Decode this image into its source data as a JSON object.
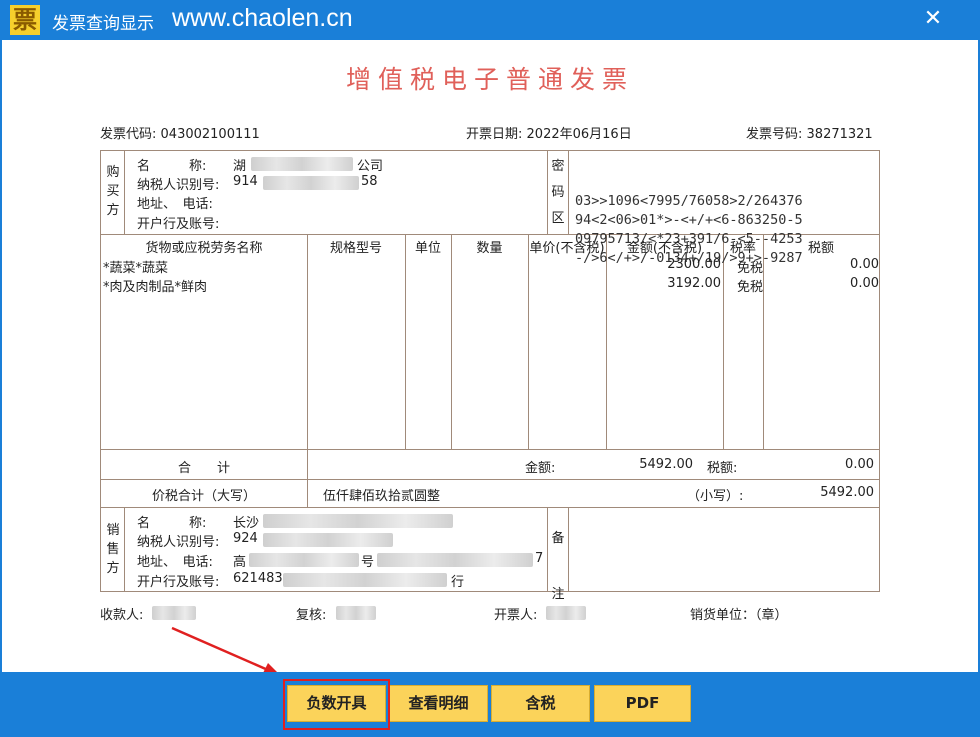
{
  "window": {
    "logo_char": "票",
    "title": "发票查询显示",
    "url": "www.chaolen.cn",
    "close_glyph": "✕"
  },
  "invoice": {
    "title": "增值税电子普通发票",
    "code_label": "发票代码:",
    "code": "043002100111",
    "date_label": "开票日期:",
    "date": "2022年06月16日",
    "number_label": "发票号码:",
    "number": "38271321"
  },
  "buyer": {
    "side_label": [
      "购",
      "买",
      "方"
    ],
    "name_label": "名　　　称:",
    "name_prefix": "湖",
    "name_suffix": "公司",
    "tax_label": "纳税人识别号:",
    "tax_prefix": "914",
    "tax_suffix": "58",
    "address_label": "地址、　电话:",
    "bank_label": "开户行及账号:"
  },
  "cipher": {
    "side_label": [
      "密",
      "码",
      "区"
    ],
    "lines": [
      "03>>1096<7995/76058>2/264376",
      "94<2<06>01*>-<+/+<6-863250-5",
      "09795713/<*23+391/6-<5--4253",
      "-/>6</+>/-0134+/19/>9+>-9287"
    ]
  },
  "items": {
    "headers": {
      "name": "货物或应税劳务名称",
      "spec": "规格型号",
      "unit": "单位",
      "qty": "数量",
      "price": "单价(不含税)",
      "amount": "金额(不含税)",
      "rate": "税率",
      "tax": "税额"
    },
    "rows": [
      {
        "name": "*蔬菜*蔬菜",
        "amount": "2300.00",
        "rate": "免税",
        "tax": "0.00"
      },
      {
        "name": "*肉及肉制品*鲜肉",
        "amount": "3192.00",
        "rate": "免税",
        "tax": "0.00"
      }
    ]
  },
  "totals": {
    "label": "合　　计",
    "amount_label": "金额:",
    "amount": "5492.00",
    "tax_label": "税额:",
    "tax": "0.00",
    "sum_label": "价税合计（大写）",
    "sum_words": "伍仟肆佰玖拾贰圆整",
    "small_label": "（小写）:",
    "sum_small": "5492.00"
  },
  "seller": {
    "side_label": [
      "销",
      "售",
      "方"
    ],
    "name_label": "名　　　称:",
    "name_prefix": "长沙",
    "tax_label": "纳税人识别号:",
    "tax_prefix": "924",
    "address_label": "地址、　电话:",
    "address_prefix": "高",
    "address_mid": "号",
    "address_suffix": "7",
    "bank_label": "开户行及账号:",
    "bank_prefix": "621483",
    "bank_suffix": "行",
    "remark_label": [
      "备",
      "注"
    ]
  },
  "footer": {
    "payee_label": "收款人:",
    "review_label": "复核:",
    "drawer_label": "开票人:",
    "seller_unit": "销货单位：（章）"
  },
  "actions": {
    "negative": "负数开具",
    "detail": "查看明细",
    "tax_incl": "含税",
    "pdf": "PDF"
  }
}
